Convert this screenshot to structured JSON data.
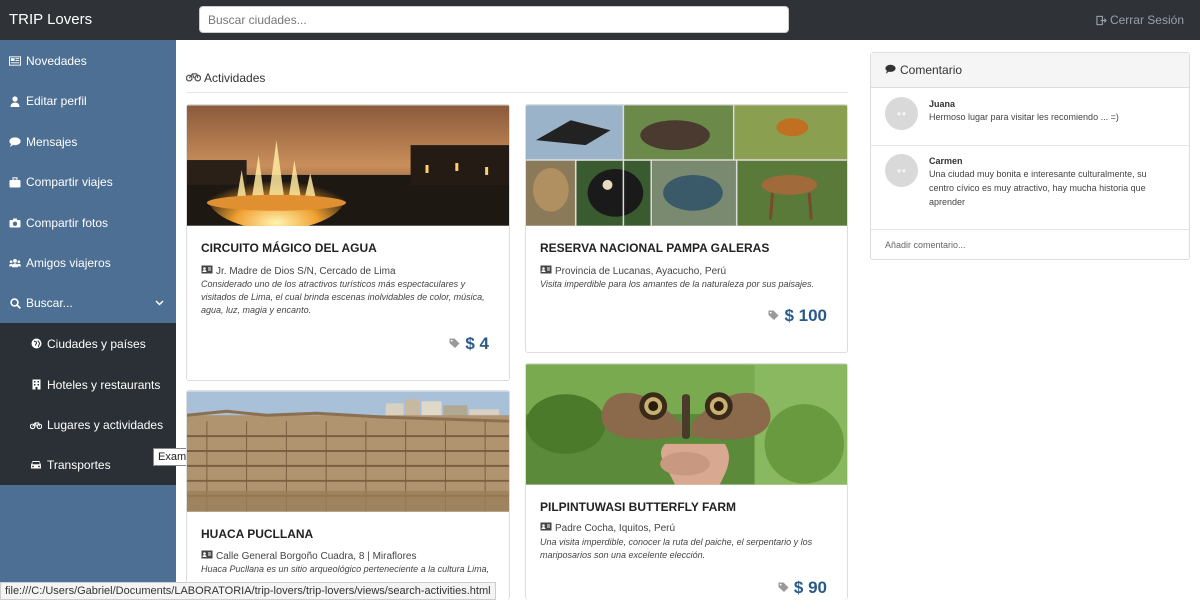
{
  "app": {
    "brand": "TRIP Lovers",
    "search_placeholder": "Buscar ciudades...",
    "logout_label": "Cerrar Sesión"
  },
  "sidebar": {
    "items": [
      {
        "label": "Novedades",
        "icon": "newspaper-icon"
      },
      {
        "label": "Editar perfil",
        "icon": "user-icon"
      },
      {
        "label": "Mensajes",
        "icon": "comment-icon"
      },
      {
        "label": "Compartir viajes",
        "icon": "suitcase-icon"
      },
      {
        "label": "Compartir fotos",
        "icon": "camera-icon"
      },
      {
        "label": "Amigos viajeros",
        "icon": "users-icon"
      },
      {
        "label": "Buscar...",
        "icon": "search-icon"
      }
    ],
    "subitems": [
      {
        "label": "Ciudades y países",
        "icon": "globe-icon"
      },
      {
        "label": "Hoteles y restaurants",
        "icon": "building-icon"
      },
      {
        "label": "Lugares y actividades",
        "icon": "bicycle-icon"
      },
      {
        "label": "Transportes",
        "icon": "car-icon"
      }
    ],
    "tooltip": "Example Pages"
  },
  "activities": {
    "section_title": "Actividades",
    "cards": [
      {
        "title": "CIRCUITO MÁGICO DEL AGUA",
        "address": "Jr. Madre de Dios S/N, Cercado de Lima",
        "description": "Considerado uno de los atractivos turísticos más espectaculares y visitados de Lima, el cual brinda escenas inolvidables de color, música, agua, luz, magia y encanto.",
        "price": "$ 4"
      },
      {
        "title": "RESERVA NACIONAL PAMPA GALERAS",
        "address": "Provincia de Lucanas, Ayacucho, Perú",
        "description": "Visita imperdible para los amantes de la naturaleza por sus paisajes.",
        "price": "$ 100"
      },
      {
        "title": "HUACA PUCLLANA",
        "address": "Calle General Borgoño Cuadra, 8 | Miraflores",
        "description": "Huaca Pucllana es un sitio arqueológico perteneciente a la cultura Lima,",
        "price": ""
      },
      {
        "title": "PILPINTUWASI BUTTERFLY FARM",
        "address": "Padre Cocha, Iquitos, Perú",
        "description": "Una visita imperdible, conocer la ruta del paiche, el serpentario y los mariposarios son una excelente elección.",
        "price": "$ 90"
      }
    ]
  },
  "comments": {
    "title": "Comentario",
    "items": [
      {
        "name": "Juana",
        "text": "Hermoso lugar para visitar les recomiendo ... =)"
      },
      {
        "name": "Carmen",
        "text": "Una ciudad muy bonita e interesante culturalmente, su centro cívico es muy atractivo, hay mucha historia que aprender"
      }
    ],
    "add_placeholder": "Añadir comentario..."
  },
  "statusbar": {
    "url": "file:///C:/Users/Gabriel/Documents/LABORATORIA/trip-lovers/trip-lovers/views/search-activities.html"
  },
  "colors": {
    "navbar": "#2f3338",
    "sidebar": "#4d6f93",
    "submenu": "#2b3036",
    "price": "#2a5a8a"
  }
}
